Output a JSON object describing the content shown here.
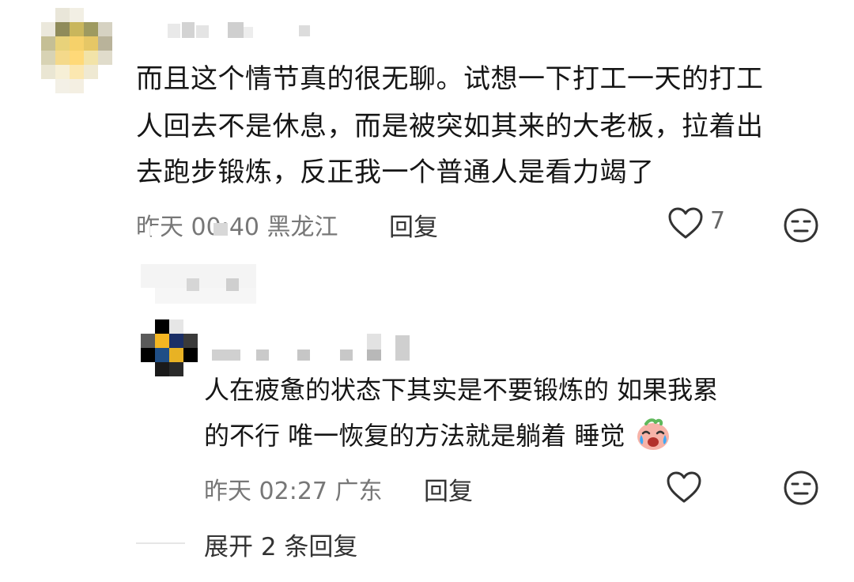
{
  "comment": {
    "lines": [
      "而且这个情节真的很无聊。试想一下打工一天的打工",
      "人回去不是休息，而是被突如其来的大老板，拉着出",
      "去跑步锻炼，反正我一个普通人是看力竭了"
    ],
    "time": "昨天 00:40",
    "location": "黑龙江",
    "reply_label": "回复",
    "like_count": "7",
    "avatar_colors": [
      "#e8e0b8",
      "#cfc27a",
      "#9b9452",
      "#f0d87a",
      "#ffe9a0",
      "#d9cfa3"
    ]
  },
  "reply": {
    "lines": [
      "人在疲惫的状态下其实是不要锻炼的 如果我累",
      "的不行 唯一恢复的方法就是躺着 睡觉"
    ],
    "emoji": "crying-laughing-emoji",
    "time": "昨天 02:27",
    "location": "广东",
    "reply_label": "回复",
    "avatar_colors": [
      "#000000",
      "#f1b61c",
      "#163c6a",
      "#2d3a5a"
    ]
  },
  "expand_label": "展开 2 条回复",
  "icons": {
    "like": "heart-outline-icon",
    "emoji": "neutral-face-icon"
  }
}
